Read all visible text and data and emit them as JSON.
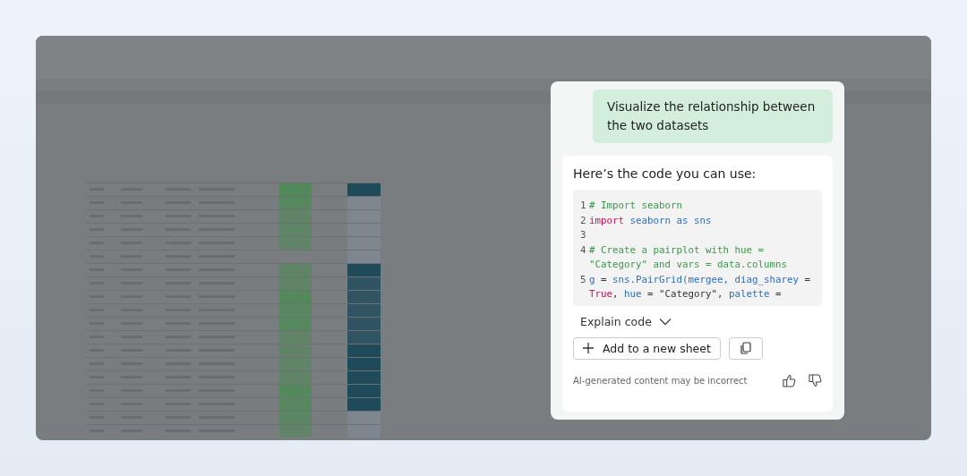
{
  "prompt": {
    "text": "Visualize the relationship between the two datasets"
  },
  "response": {
    "intro": "Here’s the code you can use:",
    "code_lines": [
      {
        "number": "1",
        "tokens": [
          {
            "kind": "comment",
            "text": "# Import seaborn"
          }
        ]
      },
      {
        "number": "2",
        "tokens": [
          {
            "kind": "keyword",
            "text": "import "
          },
          {
            "kind": "name",
            "text": "seaborn as sns"
          }
        ]
      },
      {
        "number": "3"
      },
      {
        "number": "4",
        "tokens": [
          {
            "kind": "comment",
            "text": "# Create a pairplot with hue = \"Category\" and vars = data.columns"
          }
        ]
      },
      {
        "number": "5",
        "tokens": [
          {
            "kind": "name",
            "text": "g"
          },
          {
            "kind": "plain",
            "text": " = "
          },
          {
            "kind": "name",
            "text": "sns.PairGrid(mergee, diag_sharey"
          },
          {
            "kind": "plain",
            "text": " = "
          },
          {
            "kind": "keyword",
            "text": "True"
          },
          {
            "kind": "plain",
            "text": ", "
          },
          {
            "kind": "name",
            "text": "hue"
          },
          {
            "kind": "plain",
            "text": " = \"Category\", "
          },
          {
            "kind": "name",
            "text": "palette"
          },
          {
            "kind": "plain",
            "text": " ="
          }
        ]
      }
    ],
    "explain": {
      "label": "Explain code",
      "expanded": false
    },
    "add_button": "Add to a new sheet",
    "disclaimer": "AI-generated content may be incorrect"
  }
}
